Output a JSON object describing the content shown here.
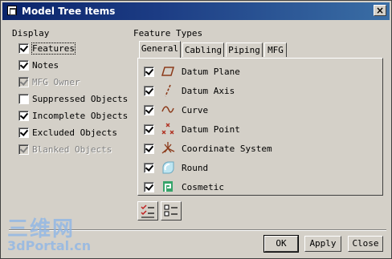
{
  "window": {
    "title": "Model Tree Items",
    "close_glyph": "×"
  },
  "display": {
    "label": "Display",
    "items": [
      {
        "label": "Features",
        "checked": true,
        "enabled": true,
        "focused": true
      },
      {
        "label": "Notes",
        "checked": true,
        "enabled": true
      },
      {
        "label": "MFG Owner",
        "checked": true,
        "enabled": false
      },
      {
        "label": "Suppressed Objects",
        "checked": false,
        "enabled": true
      },
      {
        "label": "Incomplete Objects",
        "checked": true,
        "enabled": true
      },
      {
        "label": "Excluded Objects",
        "checked": true,
        "enabled": true
      },
      {
        "label": "Blanked Objects",
        "checked": true,
        "enabled": false
      }
    ]
  },
  "feature_types": {
    "label": "Feature Types",
    "tabs": [
      {
        "label": "General",
        "active": true
      },
      {
        "label": "Cabling"
      },
      {
        "label": "Piping"
      },
      {
        "label": "MFG"
      }
    ],
    "items": [
      {
        "label": "Datum Plane",
        "checked": true,
        "icon": "datum-plane-icon"
      },
      {
        "label": "Datum Axis",
        "checked": true,
        "icon": "datum-axis-icon"
      },
      {
        "label": "Curve",
        "checked": true,
        "icon": "curve-icon"
      },
      {
        "label": "Datum Point",
        "checked": true,
        "icon": "datum-point-icon"
      },
      {
        "label": "Coordinate System",
        "checked": true,
        "icon": "coordinate-system-icon"
      },
      {
        "label": "Round",
        "checked": true,
        "icon": "round-icon"
      },
      {
        "label": "Cosmetic",
        "checked": true,
        "icon": "cosmetic-icon"
      }
    ]
  },
  "toolbar": {
    "select_all_icon": "select-all-icon",
    "clear_all_icon": "clear-all-icon"
  },
  "buttons": {
    "ok": "OK",
    "apply": "Apply",
    "close": "Close"
  },
  "watermark": {
    "line1": "三维网",
    "line2": "3dPortal.cn"
  },
  "colors": {
    "titlebar": "#0a246a",
    "face": "#d4d0c8",
    "check": "#000000",
    "icon_brown": "#8b3a1a",
    "watermark": "#8ab4e8"
  }
}
